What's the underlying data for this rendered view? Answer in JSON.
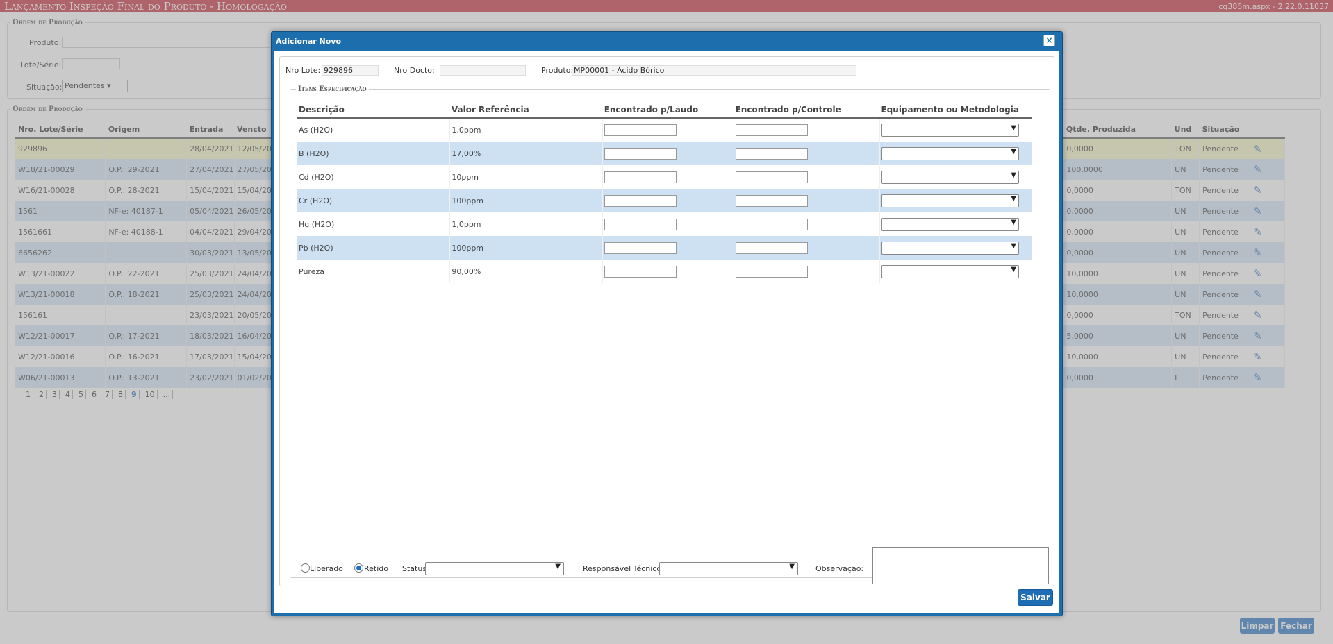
{
  "page": {
    "title": "Lançamento Inspeção Final do Produto  - Homologação",
    "version": "cq385m.aspx - 2.22.0.11037"
  },
  "filter": {
    "legend": "Ordem de Produção",
    "produto_label": "Produto:",
    "lote_label": "Lote/Série:",
    "situacao_label": "Situação:",
    "situacao_value": "Pendentes"
  },
  "list": {
    "legend": "Ordem de Produção",
    "columns": [
      "Nro. Lote/Série",
      "Origem",
      "Entrada",
      "Vencto",
      "Qtde. Produzida",
      "Und",
      "Situação"
    ],
    "rows": [
      {
        "lote": "929896",
        "origem": "",
        "entrada": "28/04/2021",
        "vencto": "12/05/20",
        "qtde": "0,0000",
        "und": "TON",
        "situacao": "Pendente"
      },
      {
        "lote": "W18/21-00029",
        "origem": "O.P.: 29-2021",
        "entrada": "27/04/2021",
        "vencto": "27/05/20",
        "qtde": "100,0000",
        "und": "UN",
        "situacao": "Pendente"
      },
      {
        "lote": "W16/21-00028",
        "origem": "O.P.: 28-2021",
        "entrada": "15/04/2021",
        "vencto": "15/04/20",
        "qtde": "0,0000",
        "und": "TON",
        "situacao": "Pendente"
      },
      {
        "lote": "1561",
        "origem": "NF-e: 40187-1",
        "entrada": "05/04/2021",
        "vencto": "26/05/20",
        "qtde": "0,0000",
        "und": "UN",
        "situacao": "Pendente"
      },
      {
        "lote": "1561661",
        "origem": "NF-e: 40188-1",
        "entrada": "04/04/2021",
        "vencto": "29/04/20",
        "qtde": "0,0000",
        "und": "UN",
        "situacao": "Pendente"
      },
      {
        "lote": "6656262",
        "origem": "",
        "entrada": "30/03/2021",
        "vencto": "13/05/20",
        "qtde": "0,0000",
        "und": "UN",
        "situacao": "Pendente"
      },
      {
        "lote": "W13/21-00022",
        "origem": "O.P.: 22-2021",
        "entrada": "25/03/2021",
        "vencto": "24/04/20",
        "qtde": "10,0000",
        "und": "UN",
        "situacao": "Pendente"
      },
      {
        "lote": "W13/21-00018",
        "origem": "O.P.: 18-2021",
        "entrada": "25/03/2021",
        "vencto": "24/04/20",
        "qtde": "10,0000",
        "und": "UN",
        "situacao": "Pendente"
      },
      {
        "lote": "156161",
        "origem": "",
        "entrada": "23/03/2021",
        "vencto": "20/05/20",
        "qtde": "0,0000",
        "und": "TON",
        "situacao": "Pendente"
      },
      {
        "lote": "W12/21-00017",
        "origem": "O.P.: 17-2021",
        "entrada": "18/03/2021",
        "vencto": "16/04/20",
        "qtde": "5,0000",
        "und": "UN",
        "situacao": "Pendente"
      },
      {
        "lote": "W12/21-00016",
        "origem": "O.P.: 16-2021",
        "entrada": "17/03/2021",
        "vencto": "15/04/20",
        "qtde": "10,0000",
        "und": "UN",
        "situacao": "Pendente"
      },
      {
        "lote": "W06/21-00013",
        "origem": "O.P.: 13-2021",
        "entrada": "23/02/2021",
        "vencto": "01/02/20",
        "qtde": "0,0000",
        "und": "L",
        "situacao": "Pendente"
      }
    ],
    "pages": [
      "1",
      "2",
      "3",
      "4",
      "5",
      "6",
      "7",
      "8",
      "9",
      "10",
      "..."
    ],
    "current_page": "9"
  },
  "bg_buttons": {
    "limpar": "Limpar",
    "fechar": "Fechar"
  },
  "dialog": {
    "title": "Adicionar Novo",
    "close": "×",
    "nro_lote_label": "Nro Lote:",
    "nro_lote_value": "929896",
    "nro_docto_label": "Nro Docto:",
    "nro_docto_value": "",
    "produto_label": "Produto:",
    "produto_value": "MP00001 - Ácido Bórico",
    "spec_legend": "Itens Especificação",
    "columns": [
      "Descrição",
      "Valor Referência",
      "Encontrado p/Laudo",
      "Encontrado p/Controle",
      "Equipamento ou Metodologia"
    ],
    "items": [
      {
        "descricao": "As (H2O)",
        "valor": "1,0ppm"
      },
      {
        "descricao": "B (H2O)",
        "valor": "17,00%"
      },
      {
        "descricao": "Cd (H2O)",
        "valor": "10ppm"
      },
      {
        "descricao": "Cr (H2O)",
        "valor": "100ppm"
      },
      {
        "descricao": "Hg (H2O)",
        "valor": "1,0ppm"
      },
      {
        "descricao": "Pb (H2O)",
        "valor": "100ppm"
      },
      {
        "descricao": "Pureza",
        "valor": "90,00%"
      }
    ],
    "liberado_label": "Liberado",
    "retido_label": "Retido",
    "selected_radio": "Retido",
    "status_label": "Status:",
    "responsavel_label": "Responsável Técnico:",
    "observacao_label": "Observação:",
    "save_label": "Salvar"
  },
  "colors": {
    "title_bar": "#c9303e",
    "dialog": "#1d6ead",
    "row_alt": "#cde1f3",
    "button": "#1f6eb5"
  }
}
